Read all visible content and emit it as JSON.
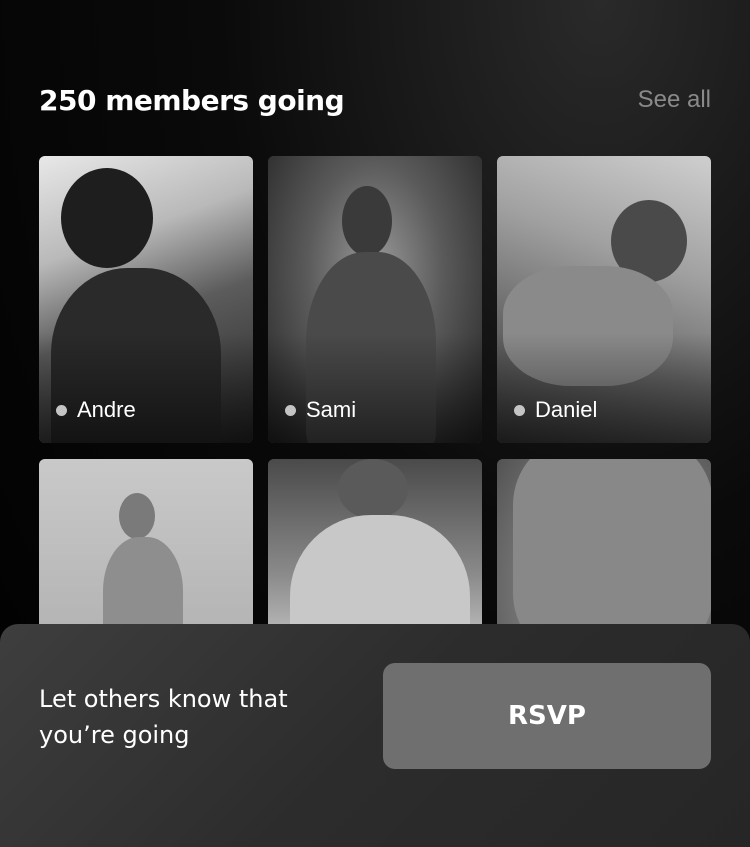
{
  "header": {
    "title": "250 members going",
    "see_all_label": "See all"
  },
  "members": [
    {
      "name": "Andre",
      "status_icon": "dot-icon"
    },
    {
      "name": "Sami",
      "status_icon": "dot-icon"
    },
    {
      "name": "Daniel",
      "status_icon": "dot-icon"
    },
    {
      "name": "",
      "status_icon": ""
    },
    {
      "name": "",
      "status_icon": ""
    },
    {
      "name": "",
      "status_icon": ""
    }
  ],
  "rsvp_sheet": {
    "prompt": "Let others know that you’re going",
    "button_label": "RSVP"
  },
  "colors": {
    "background": "#000000",
    "title": "#ffffff",
    "see_all": "#8a8a8a",
    "sheet": "#333333",
    "button": "#6f6f6f"
  }
}
